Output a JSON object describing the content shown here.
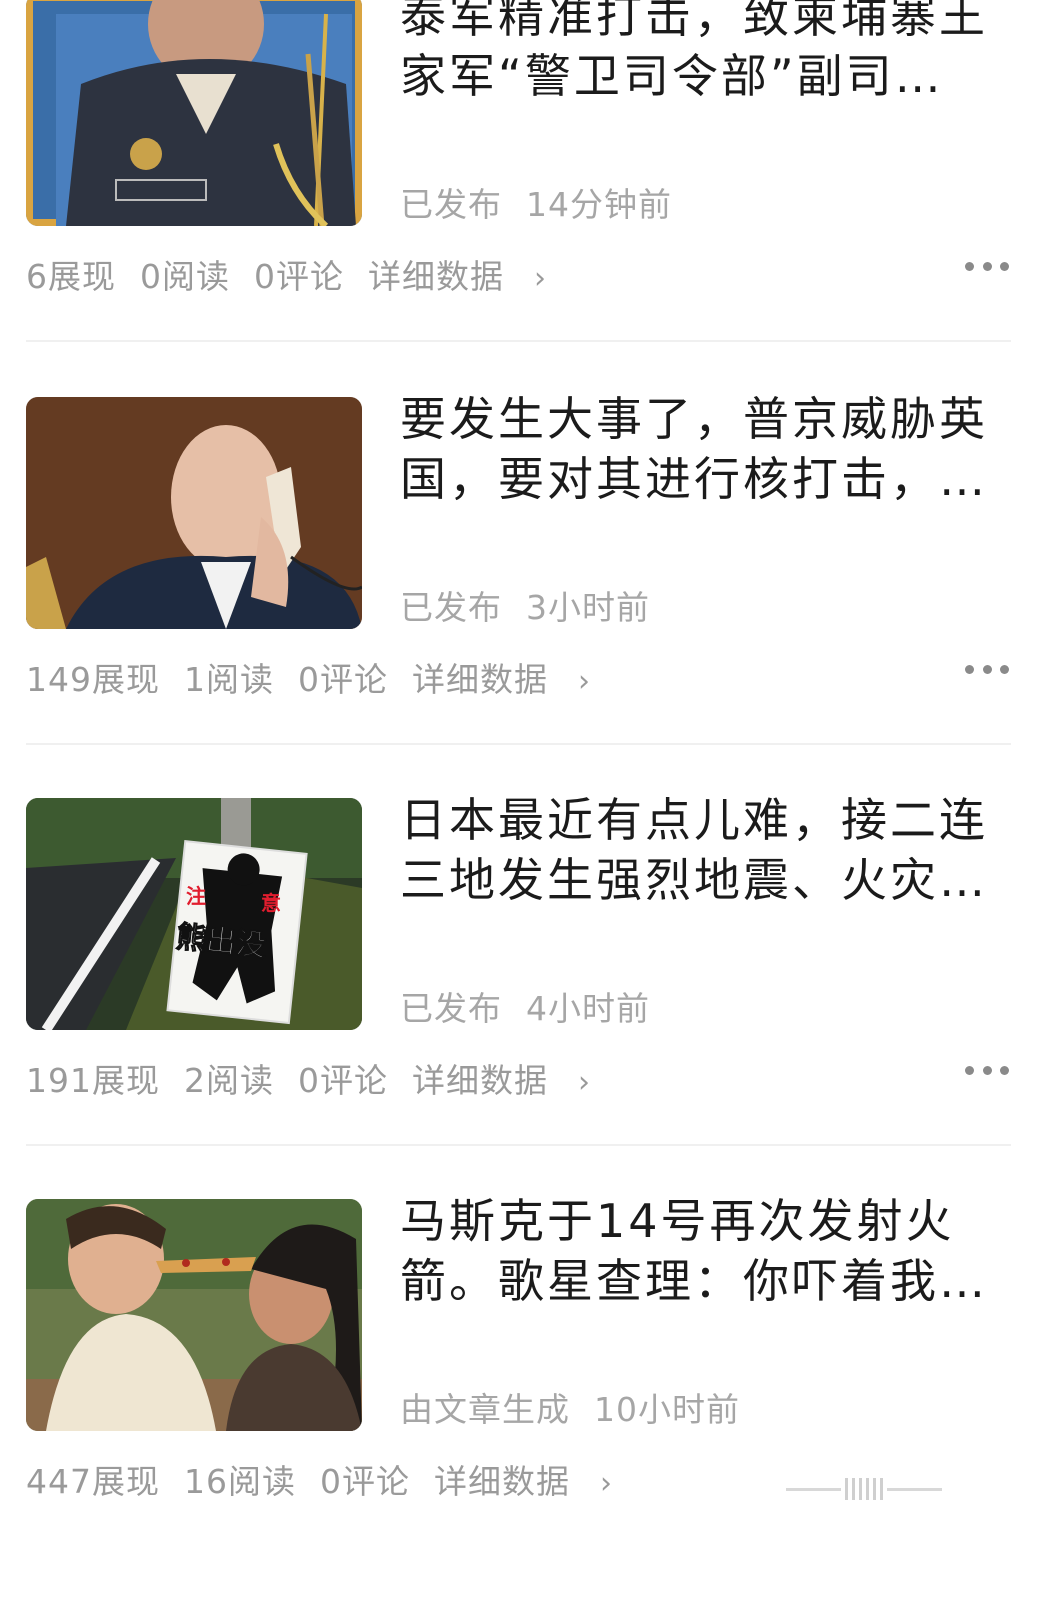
{
  "articles": [
    {
      "title": "泰军精准打击，致柬埔寨王家军“警卫司令部”副司…",
      "status_label": "已发布",
      "time": "14分钟前",
      "impressions": "6展现",
      "reads": "0阅读",
      "comments": "0评论",
      "detail_label": "详细数据",
      "thumbnail": "military-officer-portrait"
    },
    {
      "title": "要发生大事了，普京威胁英国，要对其进行核打击，…",
      "status_label": "已发布",
      "time": "3小时前",
      "impressions": "149展现",
      "reads": "1阅读",
      "comments": "0评论",
      "detail_label": "详细数据",
      "thumbnail": "man-on-telephone"
    },
    {
      "title": "日本最近有点儿难，接二连三地发生强烈地震、火灾…",
      "status_label": "已发布",
      "time": "4小时前",
      "impressions": "191展现",
      "reads": "2阅读",
      "comments": "0评论",
      "detail_label": "详细数据",
      "thumbnail": "bear-warning-sign",
      "sign_text": {
        "warn_left": "注",
        "warn_right": "意",
        "main": "熊出没"
      }
    },
    {
      "title": "马斯克于14号再次发射火箭。歌星查理：你吓着我…",
      "status_label": "由文章生成",
      "time": "10小时前",
      "impressions": "447展现",
      "reads": "16阅读",
      "comments": "0评论",
      "detail_label": "详细数据",
      "thumbnail": "couple-eating-pizza"
    }
  ],
  "icons": {
    "more": "more-dots-icon",
    "chevron": "chevron-right-icon"
  },
  "colors": {
    "title": "#1b1b1b",
    "meta": "#a6a6a6",
    "divider": "#f0f0f0"
  }
}
